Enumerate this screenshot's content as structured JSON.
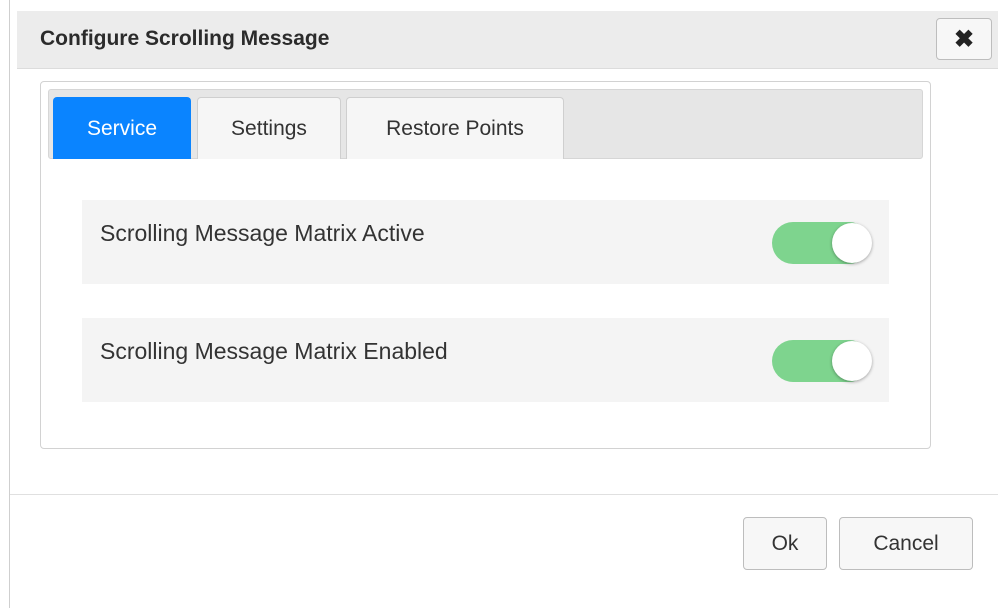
{
  "dialog": {
    "title": "Configure Scrolling Message",
    "close_icon": "close-icon"
  },
  "tabs": [
    {
      "label": "Service",
      "active": true
    },
    {
      "label": "Settings",
      "active": false
    },
    {
      "label": "Restore Points",
      "active": false
    }
  ],
  "service": {
    "rows": [
      {
        "label": "Scrolling Message Matrix Active",
        "enabled": true
      },
      {
        "label": "Scrolling Message Matrix Enabled",
        "enabled": true
      }
    ]
  },
  "footer": {
    "ok_label": "Ok",
    "cancel_label": "Cancel"
  },
  "colors": {
    "accent": "#0a84ff",
    "toggle_on": "#7ed48e"
  }
}
